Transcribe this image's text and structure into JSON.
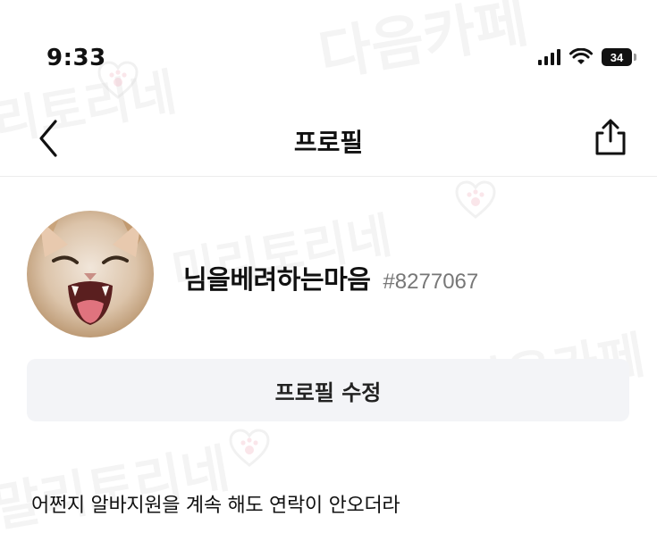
{
  "status_bar": {
    "time": "9:33",
    "battery_level": "34",
    "icons": [
      "cellular-signal-icon",
      "wifi-icon",
      "battery-icon"
    ]
  },
  "nav": {
    "title": "프로필",
    "back_icon": "chevron-left-icon",
    "share_icon": "share-icon"
  },
  "profile": {
    "avatar": "cat-avatar",
    "nickname": "님을베려하는마음",
    "user_id": "#8277067",
    "edit_button_label": "프로필 수정"
  },
  "post": {
    "text": "어쩐지 알바지원을 계속 해도 연락이 안오더라"
  },
  "watermarks": {
    "daum_cafe": "다음카페",
    "miritoriné": "미리토리네",
    "malitoriné": "말리토리네"
  },
  "colors": {
    "background": "#ffffff",
    "button_bg": "#f3f4f7",
    "id_text": "#777777",
    "divider": "#ececec"
  }
}
